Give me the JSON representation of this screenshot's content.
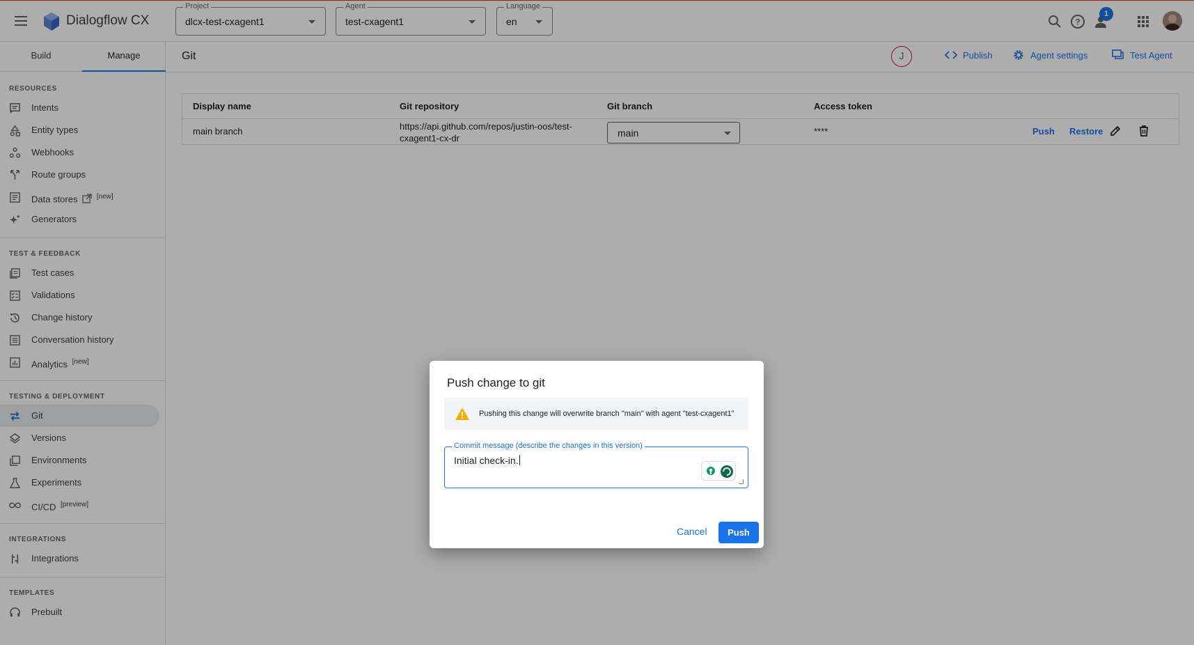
{
  "app": {
    "name": "Dialogflow CX"
  },
  "topbar": {
    "project": {
      "label": "Project",
      "value": "dlcx-test-cxagent1"
    },
    "agent": {
      "label": "Agent",
      "value": "test-cxagent1"
    },
    "language": {
      "label": "Language",
      "value": "en"
    },
    "notification_count": "1"
  },
  "sidebar": {
    "tabs": [
      "Build",
      "Manage"
    ],
    "active_tab": "Manage",
    "sections": {
      "resources": "RESOURCES",
      "test_feedback": "TEST & FEEDBACK",
      "testing_deployment": "TESTING & DEPLOYMENT",
      "integrations": "INTEGRATIONS",
      "templates": "TEMPLATES"
    },
    "items": {
      "intents": "Intents",
      "entity_types": "Entity types",
      "webhooks": "Webhooks",
      "route_groups": "Route groups",
      "data_stores": "Data stores",
      "data_stores_tag": "[new]",
      "generators": "Generators",
      "test_cases": "Test cases",
      "validations": "Validations",
      "change_history": "Change history",
      "conversation_history": "Conversation history",
      "analytics": "Analytics",
      "analytics_tag": "[new]",
      "git": "Git",
      "versions": "Versions",
      "environments": "Environments",
      "experiments": "Experiments",
      "cicd": "CI/CD",
      "cicd_tag": "[preview]",
      "integrations": "Integrations",
      "prebuilt": "Prebuilt"
    }
  },
  "header": {
    "title": "Git",
    "user_initial": "J",
    "publish": "Publish",
    "agent_settings": "Agent settings",
    "test_agent": "Test Agent"
  },
  "table": {
    "columns": [
      "Display name",
      "Git repository",
      "Git branch",
      "Access token"
    ],
    "row": {
      "display_name": "main branch",
      "repo_line1": "https://api.github.com/repos/justin-oos/test-",
      "repo_line2": "cxagent1-cx-dr",
      "branch": "main",
      "token": "****",
      "push": "Push",
      "restore": "Restore"
    }
  },
  "dialog": {
    "title": "Push change to git",
    "warning": "Pushing this change will overwrite branch \"main\" with agent \"test-cxagent1\"",
    "commit_label": "Commit message (describe the changes in this version)",
    "commit_value": "Initial check-in.",
    "cancel": "Cancel",
    "push": "Push"
  },
  "colors": {
    "accent": "#1a73e8",
    "warning": "#f9ab00",
    "overlay": "rgba(0,0,0,0.32)"
  }
}
